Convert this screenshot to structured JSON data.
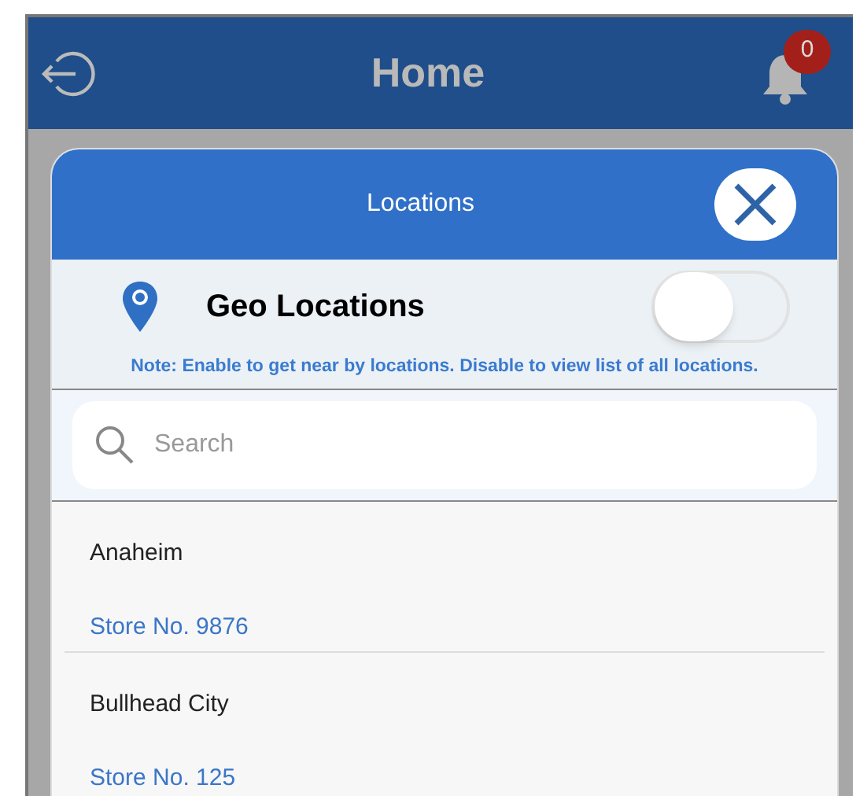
{
  "header": {
    "title": "Home",
    "notification_count": "0"
  },
  "modal": {
    "title": "Locations",
    "geo": {
      "label": "Geo Locations",
      "on": false,
      "note": "Note: Enable to get near by locations. Disable to view list of all locations."
    },
    "search": {
      "placeholder": "Search"
    },
    "locations": [
      {
        "city": "Anaheim",
        "store": "Store No. 9876"
      },
      {
        "city": "Bullhead City",
        "store": "Store No. 125"
      }
    ]
  }
}
